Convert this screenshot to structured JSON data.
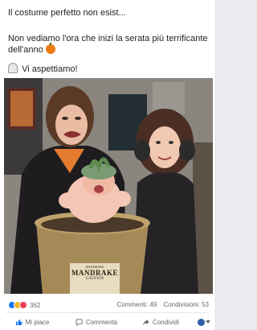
{
  "post": {
    "line1": "Il costume perfetto non esist...",
    "line2a": "Non vediamo l'ora che inizi la serata più terrificante",
    "line2b": "dell'anno",
    "line3": "Vi aspettiamo!"
  },
  "image": {
    "label_top": "MANDRAKE",
    "label_small": "MANDRAKE",
    "label_sub": "CAUTION"
  },
  "stats": {
    "reaction_count": "362",
    "comments": "Commenti: 49",
    "shares": "Condivisioni: 53"
  },
  "actions": {
    "like": "Mi piace",
    "comment": "Commenta",
    "share": "Condividi"
  },
  "icons": [
    "pumpkin-icon",
    "ghost-icon",
    "like-icon",
    "comment-icon",
    "share-icon",
    "chevron-down-icon"
  ],
  "colors": {
    "facebook_blue": "#1877f2",
    "love": "#f33e58",
    "haha": "#f7b928"
  }
}
